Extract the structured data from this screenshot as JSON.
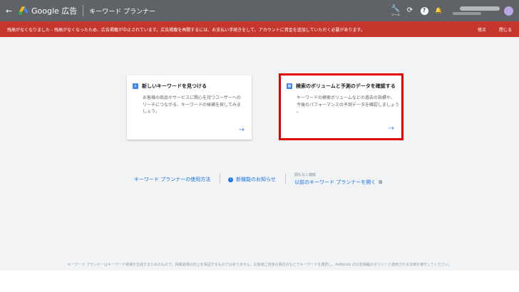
{
  "topbar": {
    "back_icon": "←",
    "brand": "Google 広告",
    "tool_title": "キーワード プランナー",
    "tools_label": "ツール",
    "refresh_icon": "⟳",
    "help_icon": "?",
    "bell_icon": "🔔"
  },
  "alert": {
    "message": "残高がなくなりました - 残高がなくなったため、広告掲載が中止されています。広告掲載を再開するには、お支払い手続きをして、アカウントに資金を追加していただく必要があります。",
    "fix": "修正",
    "close": "閉じる"
  },
  "cards": [
    {
      "title": "新しいキーワードを見つける",
      "desc_lines": [
        "お客様の商品やサービスに関心を持つユーザーへの",
        "リーチにつながる、キーワードの候補を探してみま",
        "しょう。"
      ],
      "arrow": "→"
    },
    {
      "title": "検索のボリュームと予測のデータを確認する",
      "desc_lines": [
        "キーワードの検索ボリュームなどの過去の指標や、",
        "今後のパフォーマンスの予測データを確認しましょう",
        "。"
      ],
      "arrow": "→"
    }
  ],
  "links": {
    "how_to": "キーワード プランナーの使用方法",
    "new_features": "新機能のお知らせ",
    "soon_removed": "間もなく廃除",
    "previous": "以前のキーワード プランナーを開く"
  },
  "footer": "キーワード プランナーはキーワード候補を生成するためのもので、掲載結果の向上を保証するものではありません。お客様ご自身の責任のもとでキーワードを選択し、AdWords の広告掲載のポリシーと適用される法律を遵守してください。",
  "colors": {
    "topbar": "#5f6368",
    "alert": "#c5372c",
    "accent": "#1a73e8",
    "highlight": "#e00000"
  }
}
